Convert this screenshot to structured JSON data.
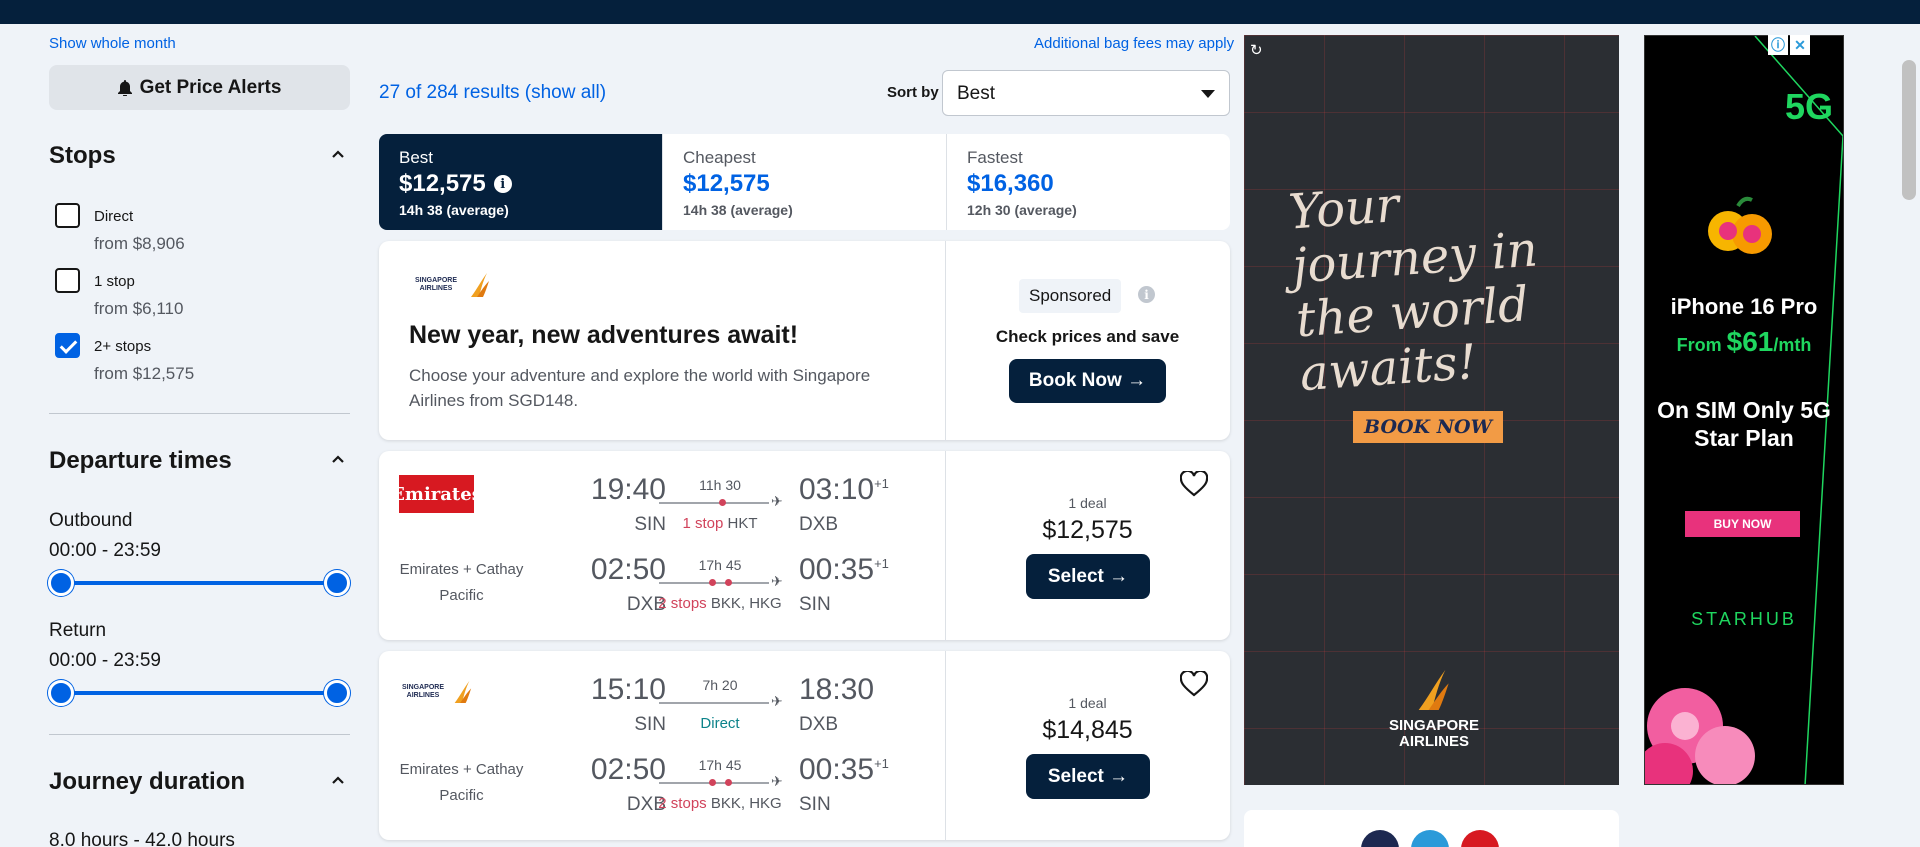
{
  "sidebar": {
    "show_month": "Show whole month",
    "price_alerts": "Get Price Alerts",
    "stops": {
      "title": "Stops",
      "options": [
        {
          "label": "Direct",
          "from": "from $8,906",
          "checked": false
        },
        {
          "label": "1 stop",
          "from": "from $6,110",
          "checked": false
        },
        {
          "label": "2+ stops",
          "from": "from $12,575",
          "checked": true
        }
      ]
    },
    "departure": {
      "title": "Departure times",
      "outbound_label": "Outbound",
      "outbound_range": "00:00 - 23:59",
      "return_label": "Return",
      "return_range": "00:00 - 23:59"
    },
    "journey": {
      "title": "Journey duration",
      "range": "8.0 hours - 42.0 hours"
    }
  },
  "header": {
    "results": "27 of 284 results (show all)",
    "sort_label": "Sort by",
    "sort_value": "Best",
    "bag_fees": "Additional bag fees may apply"
  },
  "tabs": [
    {
      "label": "Best",
      "price": "$12,575",
      "duration": "14h 38 (average)",
      "active": true
    },
    {
      "label": "Cheapest",
      "price": "$12,575",
      "duration": "14h 38 (average)",
      "active": false
    },
    {
      "label": "Fastest",
      "price": "$16,360",
      "duration": "12h 30 (average)",
      "active": false
    }
  ],
  "sponsored_card": {
    "logo_text": "SINGAPORE AIRLINES",
    "title": "New year, new adventures await!",
    "description": "Choose your adventure and explore the world with Singapore Airlines from SGD148.",
    "badge": "Sponsored",
    "cta_text": "Check prices and save",
    "button": "Book Now →"
  },
  "results": [
    {
      "logo": "Emirates",
      "operators": "Emirates + Cathay Pacific",
      "outbound": {
        "dep_time": "19:40",
        "dep_apt": "SIN",
        "duration": "11h 30",
        "stops": "1 stop",
        "via": "HKT",
        "arr_time": "03:10",
        "arr_offset": "+1",
        "arr_apt": "DXB"
      },
      "return": {
        "dep_time": "02:50",
        "dep_apt": "DXB",
        "duration": "17h 45",
        "stops": "2 stops",
        "via": "BKK, HKG",
        "arr_time": "00:35",
        "arr_offset": "+1",
        "arr_apt": "SIN"
      },
      "deals": "1 deal",
      "price": "$12,575",
      "button": "Select →"
    },
    {
      "logo": "SINGAPORE AIRLINES",
      "operators": "Emirates + Cathay Pacific",
      "outbound": {
        "dep_time": "15:10",
        "dep_apt": "SIN",
        "duration": "7h 20",
        "stops": "Direct",
        "via": "",
        "arr_time": "18:30",
        "arr_offset": "",
        "arr_apt": "DXB"
      },
      "return": {
        "dep_time": "02:50",
        "dep_apt": "DXB",
        "duration": "17h 45",
        "stops": "2 stops",
        "via": "BKK, HKG",
        "arr_time": "00:35",
        "arr_offset": "+1",
        "arr_apt": "SIN"
      },
      "deals": "1 deal",
      "price": "$14,845",
      "button": "Select →"
    }
  ],
  "ads": {
    "singapore": {
      "headline": "Your journey in the world awaits!",
      "button": "BOOK NOW",
      "brand": "SINGAPORE AIRLINES"
    },
    "starhub": {
      "badge": "5G",
      "product": "iPhone 16 Pro",
      "from_prefix": "From ",
      "price": "$61",
      "per": "/mth",
      "plan": "On SIM Only 5G Star Plan",
      "button": "BUY NOW",
      "brand": "STARHUB"
    }
  },
  "colors": {
    "brand_dark": "#05203c",
    "accent": "#0062e3",
    "stops_red": "#d1435b",
    "direct_green": "#0c838a"
  }
}
